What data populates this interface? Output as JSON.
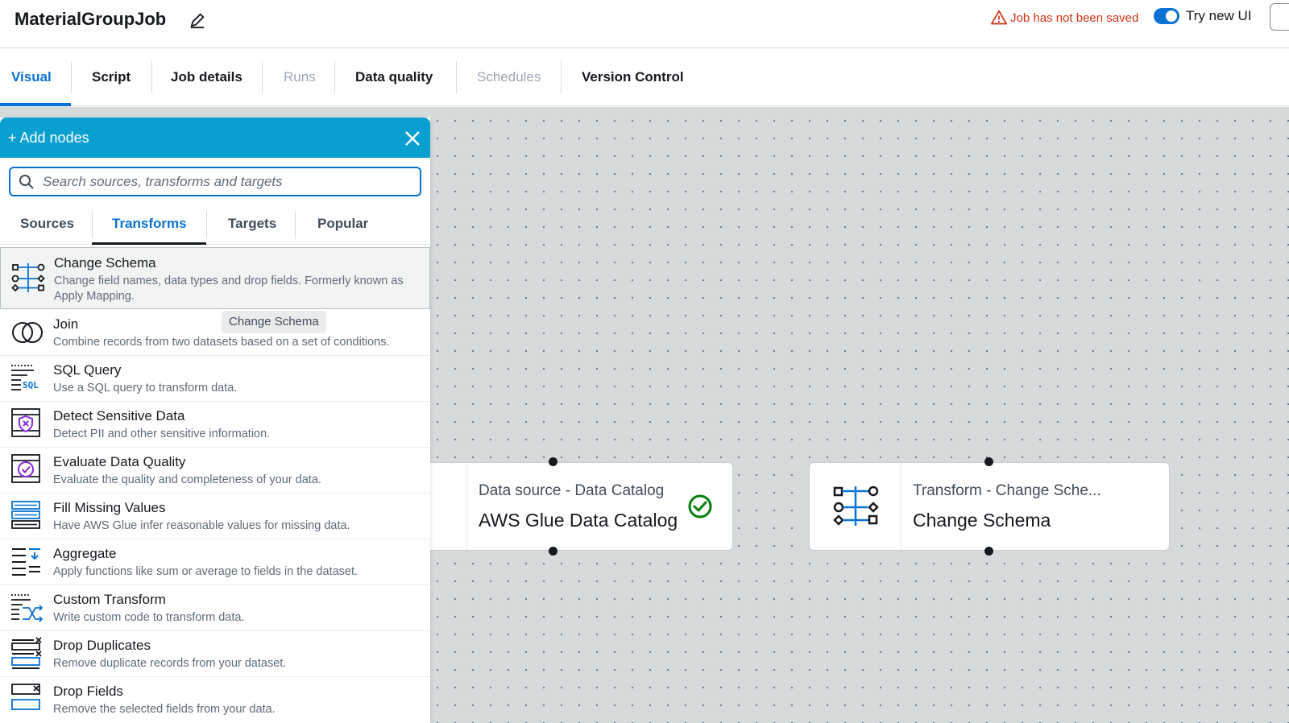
{
  "header": {
    "job_title": "MaterialGroupJob",
    "warning_text": "Job has not been saved",
    "toggle_label": "Try new UI",
    "toggle_on": true
  },
  "tabs": [
    {
      "label": "Visual",
      "state": "active"
    },
    {
      "label": "Script",
      "state": "normal"
    },
    {
      "label": "Job details",
      "state": "normal"
    },
    {
      "label": "Runs",
      "state": "disabled"
    },
    {
      "label": "Data quality",
      "state": "normal"
    },
    {
      "label": "Schedules",
      "state": "disabled"
    },
    {
      "label": "Version Control",
      "state": "normal"
    }
  ],
  "panel": {
    "title": "+ Add nodes",
    "search_placeholder": "Search sources, transforms and targets",
    "tabs": [
      {
        "label": "Sources"
      },
      {
        "label": "Transforms",
        "active": true
      },
      {
        "label": "Targets"
      },
      {
        "label": "Popular"
      }
    ],
    "tooltip": "Change Schema",
    "items": [
      {
        "name": "Change Schema",
        "desc": "Change field names, data types and drop fields. Formerly known as Apply Mapping.",
        "icon": "change-schema-icon"
      },
      {
        "name": "Join",
        "desc": "Combine records from two datasets based on a set of conditions.",
        "icon": "join-icon"
      },
      {
        "name": "SQL Query",
        "desc": "Use a SQL query to transform data.",
        "icon": "sql-query-icon"
      },
      {
        "name": "Detect Sensitive Data",
        "desc": "Detect PII and other sensitive information.",
        "icon": "shield-icon"
      },
      {
        "name": "Evaluate Data Quality",
        "desc": "Evaluate the quality and completeness of your data.",
        "icon": "check-circle-icon"
      },
      {
        "name": "Fill Missing Values",
        "desc": "Have AWS Glue infer reasonable values for missing data.",
        "icon": "fill-rows-icon"
      },
      {
        "name": "Aggregate",
        "desc": "Apply functions like sum or average to fields in the dataset.",
        "icon": "aggregate-icon"
      },
      {
        "name": "Custom Transform",
        "desc": "Write custom code to transform data.",
        "icon": "custom-transform-icon"
      },
      {
        "name": "Drop Duplicates",
        "desc": "Remove duplicate records from your dataset.",
        "icon": "drop-duplicates-icon"
      },
      {
        "name": "Drop Fields",
        "desc": "Remove the selected fields from your data.",
        "icon": "drop-fields-icon"
      }
    ]
  },
  "canvas": {
    "nodes": [
      {
        "subtitle": "Data source - Data Catalog",
        "title": "AWS Glue Data Catalog",
        "status": "success"
      },
      {
        "subtitle": "Transform - Change Sche...",
        "title": "Change Schema"
      }
    ]
  },
  "colors": {
    "accent": "#0972d3",
    "panel_header": "#0a9fd1",
    "warning": "#d13212",
    "success": "#037f0c",
    "icon_purple": "#8a2be2"
  }
}
